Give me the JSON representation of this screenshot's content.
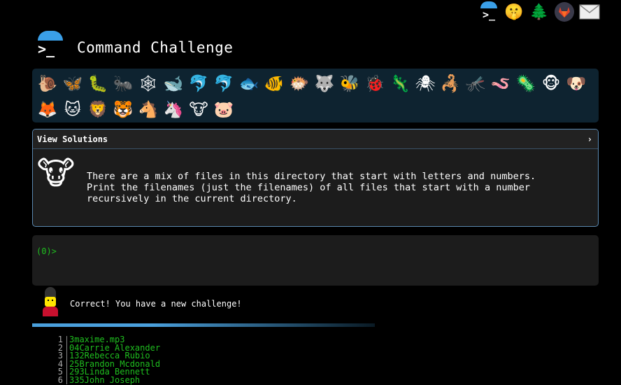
{
  "topbar": {
    "icons": [
      "terminal-icon",
      "shush-face-icon",
      "tree-icon",
      "gitlab-icon",
      "mail-icon"
    ]
  },
  "header": {
    "logo_glyph": ">_",
    "title": "Command Challenge"
  },
  "animals": {
    "icons": [
      "🐌",
      "🦋",
      "🐛",
      "🐜",
      "🕸",
      "🐋",
      "🐬",
      "🐬",
      "🐟",
      "🐠",
      "🐡",
      "🐺",
      "🐝",
      "🐞",
      "🦎",
      "🕷",
      "🦂",
      "🦟",
      "🪱",
      "🦠",
      "🐵",
      "🐶",
      "🦊",
      "🐱",
      "🦁",
      "🐯",
      "🐴",
      "🦄",
      "🐮",
      "🐷"
    ],
    "names": [
      "snail-icon",
      "butterfly-icon",
      "caterpillar-icon",
      "ant-icon",
      "spider-web-icon",
      "whale-icon",
      "shark-icon",
      "dolphin-icon",
      "fish-icon",
      "tropical-fish-icon",
      "blowfish-icon",
      "wolf-icon",
      "bee-icon",
      "ladybug-icon",
      "lizard-icon",
      "spider-icon",
      "scorpion-icon",
      "mosquito-icon",
      "worm-icon",
      "microbe-icon",
      "monkey-icon",
      "dog-icon",
      "fox-icon",
      "cat-icon",
      "lion-icon",
      "tiger-icon",
      "horse-icon",
      "unicorn-icon",
      "cow-icon",
      "pig-icon"
    ]
  },
  "panel": {
    "header_label": "View Solutions",
    "chevron": "›",
    "avatar": "🐮",
    "challenge_text": "There are a mix of files in this directory that start with letters and numbers.\nPrint the filenames (just the filenames) of all files that start with a number\nrecursively in the current directory."
  },
  "terminal": {
    "prompt": "(0)>",
    "value": ""
  },
  "status": {
    "message": "Correct! You have a new challenge!"
  },
  "output": {
    "lines": [
      {
        "n": "1",
        "text": "3maxime.mp3"
      },
      {
        "n": "2",
        "text": "04Carrie Alexander"
      },
      {
        "n": "3",
        "text": "132Rebecca Rubio"
      },
      {
        "n": "4",
        "text": "25Brandon Mcdonald"
      },
      {
        "n": "5",
        "text": "293Linda Bennett"
      },
      {
        "n": "6",
        "text": "335John Joseph"
      }
    ]
  }
}
